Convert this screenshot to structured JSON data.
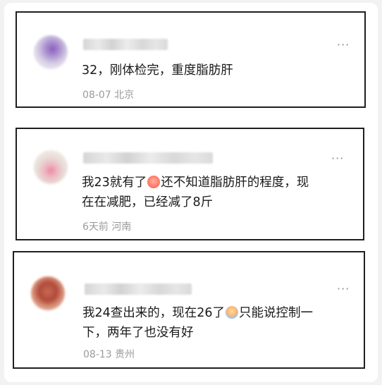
{
  "comments": [
    {
      "text": "32，刚体检完，重度脂肪肝",
      "date": "08-07",
      "location": "北京"
    },
    {
      "text_part1": "我23就有了",
      "emoji": "crying-face-emoji",
      "text_part2": "还不知道脂肪肝的程度，现",
      "text_line2": "在在减肥，已经减了8斤",
      "date": "6天前",
      "location": "河南"
    },
    {
      "text_part1": "我24查出来的，现在26了",
      "emoji": "crying-face-emoji",
      "text_part2": "只能说控制一",
      "text_line2": "下，两年了也没有好",
      "date": "08-13",
      "location": "贵州"
    }
  ],
  "more_label": "···",
  "colors": {
    "border": "#1f1f1f",
    "meta_text": "#9a9a9a",
    "body_text": "#1a1a1a"
  }
}
